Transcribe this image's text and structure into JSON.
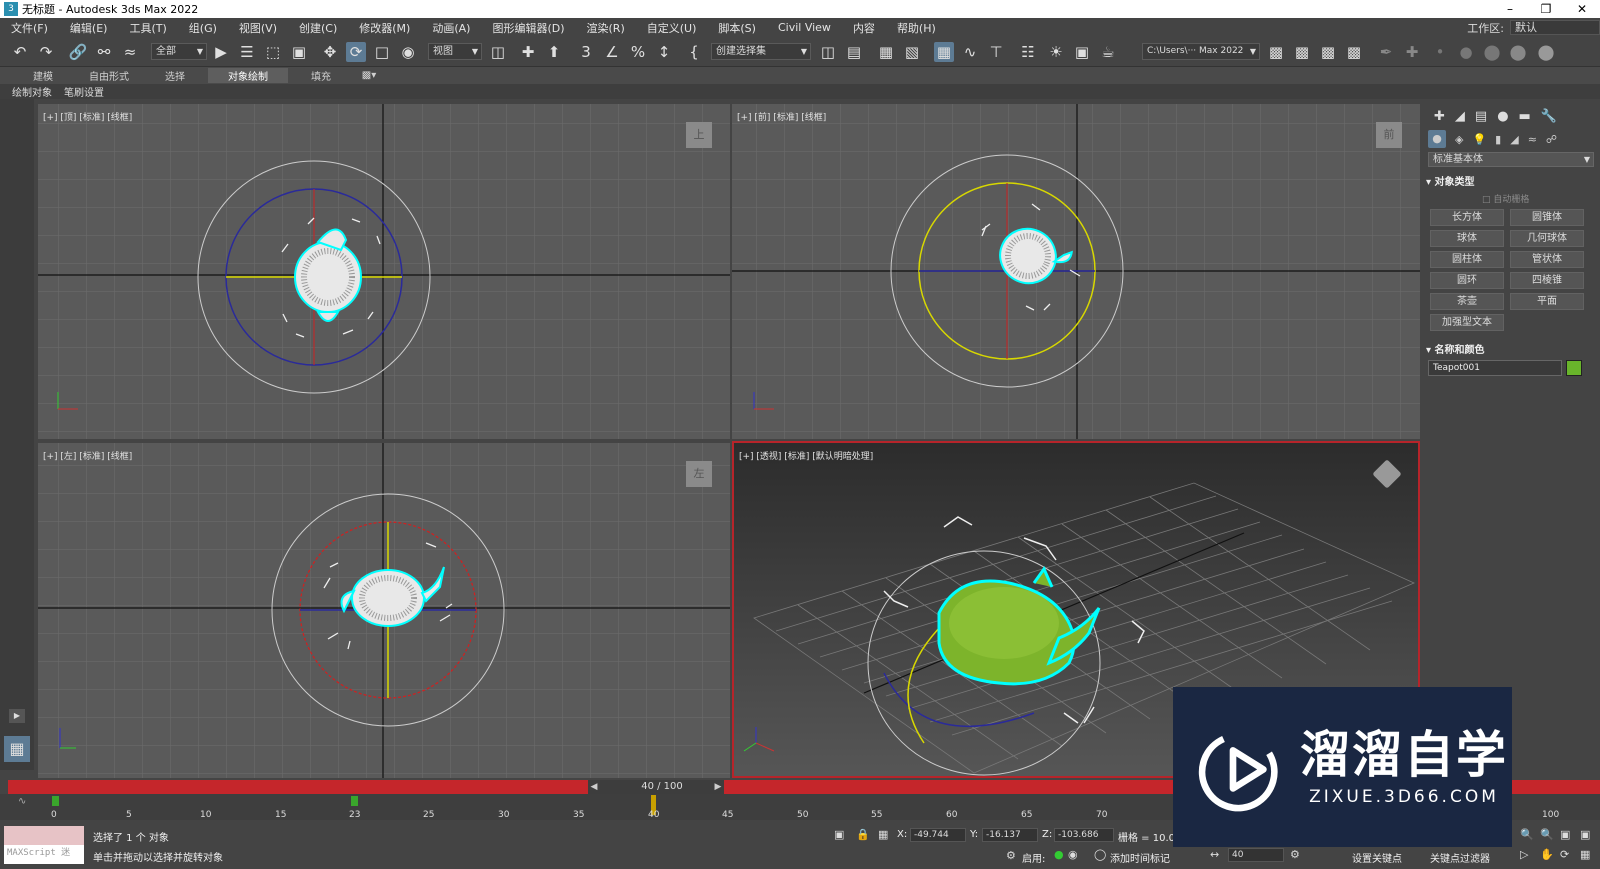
{
  "window": {
    "title": "无标题 - Autodesk 3ds Max 2022",
    "app_icon": "3dsmax-icon",
    "controls": [
      "minimize-icon",
      "restore-icon",
      "close-icon"
    ]
  },
  "menubar": {
    "items": [
      "文件(F)",
      "编辑(E)",
      "工具(T)",
      "组(G)",
      "视图(V)",
      "创建(C)",
      "修改器(M)",
      "动画(A)",
      "图形编辑器(D)",
      "渲染(R)",
      "自定义(U)",
      "脚本(S)",
      "Civil View",
      "内容",
      "帮助(H)"
    ],
    "workspace_label": "工作区:",
    "workspace_value": "默认"
  },
  "toolbar": {
    "selection_filter": "全部",
    "ref_coord": "视图",
    "named_selection": "创建选择集",
    "project_path": "C:\\Users\\··· Max 2022"
  },
  "ribbon": {
    "tabs": [
      "建模",
      "自由形式",
      "选择",
      "对象绘制",
      "填充"
    ],
    "active": "对象绘制"
  },
  "subribbon": {
    "items": [
      "绘制对象",
      "笔刷设置"
    ]
  },
  "viewports": {
    "top": {
      "label": "[+] [顶] [标准] [线框]",
      "cube": "上"
    },
    "front": {
      "label": "[+] [前] [标准] [线框]",
      "cube": "前"
    },
    "left": {
      "label": "[+] [左] [标准] [线框]",
      "cube": "左"
    },
    "perspective": {
      "label": "[+] [透视] [标准] [默认明暗处理]"
    }
  },
  "command_panel": {
    "dropdown": "标准基本体",
    "rollout_object_type": "对象类型",
    "autogrid": "自动栅格",
    "buttons": [
      "长方体",
      "圆锥体",
      "球体",
      "几何球体",
      "圆柱体",
      "管状体",
      "圆环",
      "四棱锥",
      "茶壶",
      "平面",
      "加强型文本"
    ],
    "rollout_name_color": "名称和颜色",
    "object_name": "Teapot001",
    "object_color": "#69b52b"
  },
  "timeline": {
    "frame_display": "40 / 100",
    "current_frame": 40,
    "total_frames": 100,
    "ticks": [
      "0",
      "5",
      "10",
      "15",
      "23",
      "25",
      "30",
      "35",
      "40",
      "45",
      "50",
      "55",
      "60",
      "65",
      "70",
      "100"
    ]
  },
  "status": {
    "maxscript": "MAXScript 迷",
    "selection": "选择了 1 个 对象",
    "prompt": "单击并拖动以选择并旋转对象",
    "x_label": "X:",
    "x": "-49.744",
    "y_label": "Y:",
    "y": "-16.137",
    "z_label": "Z:",
    "z": "-103.686",
    "grid": "栅格 = 10.0m",
    "enable": "启用:",
    "add_time_tag": "添加时间标记",
    "frame_field": "40",
    "set_key": "设置关键点",
    "key_filters": "关键点过滤器"
  },
  "watermark": {
    "cn": "溜溜自学",
    "en": "ZIXUE.3D66.COM"
  },
  "colors": {
    "accent": "#5d7b94",
    "timeline_red": "#c5262b",
    "teapot": "#69b52b",
    "selection": "#00ffff"
  }
}
